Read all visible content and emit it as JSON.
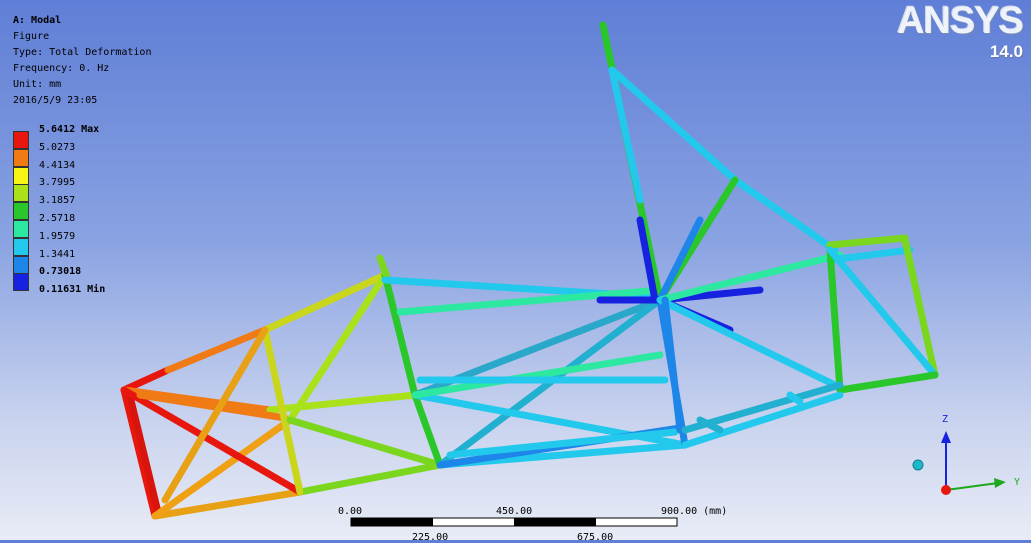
{
  "info": {
    "title": "A: Modal",
    "line1": "Figure",
    "line2": "Type: Total Deformation",
    "line3": "Frequency: 0. Hz",
    "line4": "Unit: mm",
    "line5": "2016/5/9 23:05"
  },
  "legend": [
    {
      "label": "5.6412 Max",
      "color": "#e8170d",
      "bold": true
    },
    {
      "label": "5.0273",
      "color": "#f07a14"
    },
    {
      "label": "4.4134",
      "color": "#f7f513"
    },
    {
      "label": "3.7995",
      "color": "#a9e21b"
    },
    {
      "label": "3.1857",
      "color": "#29c729"
    },
    {
      "label": "2.5718",
      "color": "#2de8a0"
    },
    {
      "label": "1.9579",
      "color": "#22c9ec"
    },
    {
      "label": "1.3441",
      "color": "#1e86e8"
    },
    {
      "label": "0.73018",
      "color": "#1622e0",
      "bold": true
    }
  ],
  "legend_min": "0.11631 Min",
  "logo": {
    "name": "ANSYS",
    "version": "14.0"
  },
  "scale_bar": {
    "top_labels": [
      "0.00",
      "450.00",
      "900.00 (mm)"
    ],
    "bottom_labels": [
      "225.00",
      "675.00"
    ]
  },
  "triad": {
    "z": "Z",
    "y": "Y"
  }
}
